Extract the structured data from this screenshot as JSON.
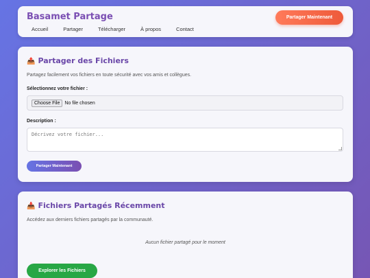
{
  "header": {
    "brand": "Basamet Partage",
    "nav": [
      "Accueil",
      "Partager",
      "Télécharger",
      "À propos",
      "Contact"
    ],
    "cta": "Partager Maintenant"
  },
  "upload": {
    "icon": "outbox-tray-icon",
    "title": "Partager des Fichiers",
    "description": "Partagez facilement vos fichiers en toute sécurité avec vos amis et collègues.",
    "file_label": "Sélectionnez votre fichier :",
    "choose_file": "Choose File",
    "no_file": "No file chosen",
    "desc_label": "Description :",
    "desc_placeholder": "Décrivez votre fichier...",
    "submit": "Partager Maintenant"
  },
  "recent": {
    "icon": "inbox-tray-icon",
    "title": "Fichiers Partagés Récemment",
    "description": "Accédez aux derniers fichiers partagés par la communauté.",
    "empty": "Aucun fichier partagé pour le moment",
    "explore": "Explorer les Fichiers"
  },
  "colors": {
    "background_start": "#6674e4",
    "background_end": "#7656b4",
    "brand": "#7b4fb3",
    "cta": "#ee5a3a",
    "explore": "#28a745"
  }
}
